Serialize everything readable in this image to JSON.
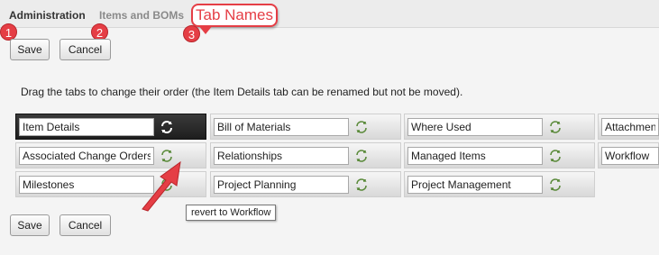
{
  "tabs": {
    "administration": "Administration",
    "items_and_boms": "Items and BOMs",
    "tab_names": "Tab Names"
  },
  "callout": {
    "label": "Tab Names"
  },
  "badges": [
    "1",
    "2",
    "3"
  ],
  "buttons": {
    "save": "Save",
    "cancel": "Cancel"
  },
  "instruction": "Drag the tabs to change their order (the Item Details tab can be renamed but not be moved).",
  "tab_fields": [
    [
      "Item Details",
      "Bill of Materials",
      "Where Used",
      "Attachments"
    ],
    [
      "Associated Change Orders",
      "Relationships",
      "Managed Items",
      "Workflow"
    ],
    [
      "Milestones",
      "Project Planning",
      "Project Management",
      ""
    ]
  ],
  "tooltip": "revert to Workflow",
  "colors": {
    "accent_red": "#e53e45",
    "refresh_icon_green": "#5a8a3a"
  }
}
